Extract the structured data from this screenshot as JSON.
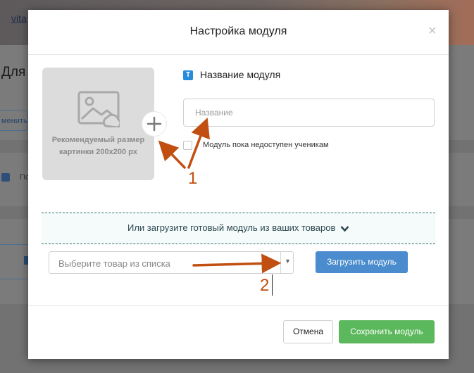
{
  "background": {
    "link_text": "vita",
    "heading": "Для",
    "button_fragment": "менить",
    "checkbox_fragment": "По"
  },
  "modal": {
    "title": "Настройка модуля",
    "close_symbol": "×",
    "image_hint_line1": "Рекомендуемый размер",
    "image_hint_line2": "картинки 200x200 px",
    "name_section_label": "Название модуля",
    "name_section_icon_text": "T",
    "name_input_placeholder": "Название",
    "name_input_value": "",
    "unavailable_checkbox_label": "Модуль пока недоступен ученикам",
    "unavailable_checked": false,
    "import_prompt": "Или загрузите готовый модуль из ваших товаров",
    "product_select_placeholder": "Выберите товар из списка",
    "upload_button": "Загрузить модуль",
    "cancel_button": "Отмена",
    "save_button": "Сохранить модуль"
  },
  "annotations": {
    "label_1": "1",
    "label_2": "2",
    "color": "#c14f12"
  },
  "colors": {
    "primary_blue": "#4a8ccd",
    "success_green": "#5cb85c",
    "dashed_border": "#2d6e68"
  },
  "icons": [
    "image-placeholder-icon",
    "plus-icon",
    "text-icon",
    "chevron-down-icon",
    "caret-down-icon",
    "close-icon"
  ]
}
